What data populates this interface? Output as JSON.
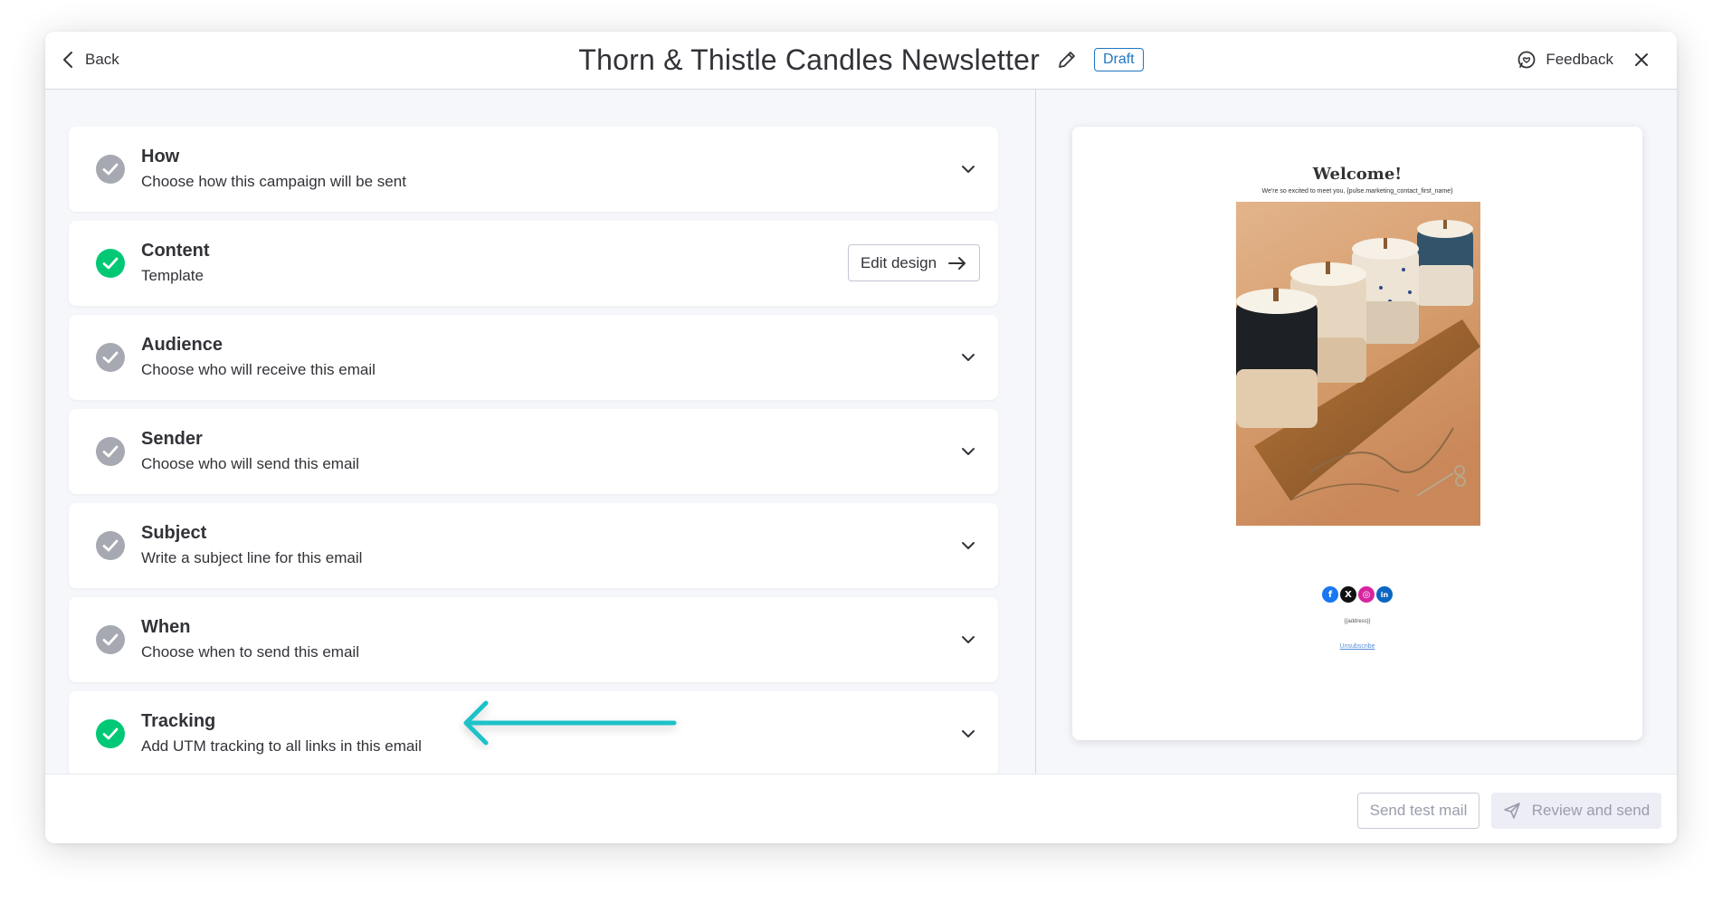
{
  "header": {
    "back_label": "Back",
    "title": "Thorn & Thistle Candles Newsletter",
    "status_badge": "Draft",
    "feedback_label": "Feedback"
  },
  "steps": [
    {
      "title": "How",
      "subtitle": "Choose how this campaign will be sent",
      "status": "incomplete"
    },
    {
      "title": "Content",
      "subtitle": "Template",
      "status": "complete",
      "action_label": "Edit design"
    },
    {
      "title": "Audience",
      "subtitle": "Choose who will receive this email",
      "status": "incomplete"
    },
    {
      "title": "Sender",
      "subtitle": "Choose who will send this email",
      "status": "incomplete"
    },
    {
      "title": "Subject",
      "subtitle": "Write a subject line for this email",
      "status": "incomplete"
    },
    {
      "title": "When",
      "subtitle": "Choose when to send this email",
      "status": "incomplete"
    },
    {
      "title": "Tracking",
      "subtitle": "Add UTM tracking to all links in this email",
      "status": "complete"
    }
  ],
  "preview": {
    "heading": "Welcome!",
    "subheading": "We're so excited to meet you, {pulse.marketing_contact_first_name}",
    "address": "{{address}}",
    "unsubscribe": "Unsubscribe",
    "socials": [
      "facebook-icon",
      "x-icon",
      "instagram-icon",
      "linkedin-icon"
    ]
  },
  "footer": {
    "send_test_label": "Send test mail",
    "review_send_label": "Review and send"
  },
  "colors": {
    "complete": "#00c875",
    "incomplete": "#a7a9b2",
    "accent": "#1f76c2",
    "annotation_arrow": "#1fc2c8"
  }
}
